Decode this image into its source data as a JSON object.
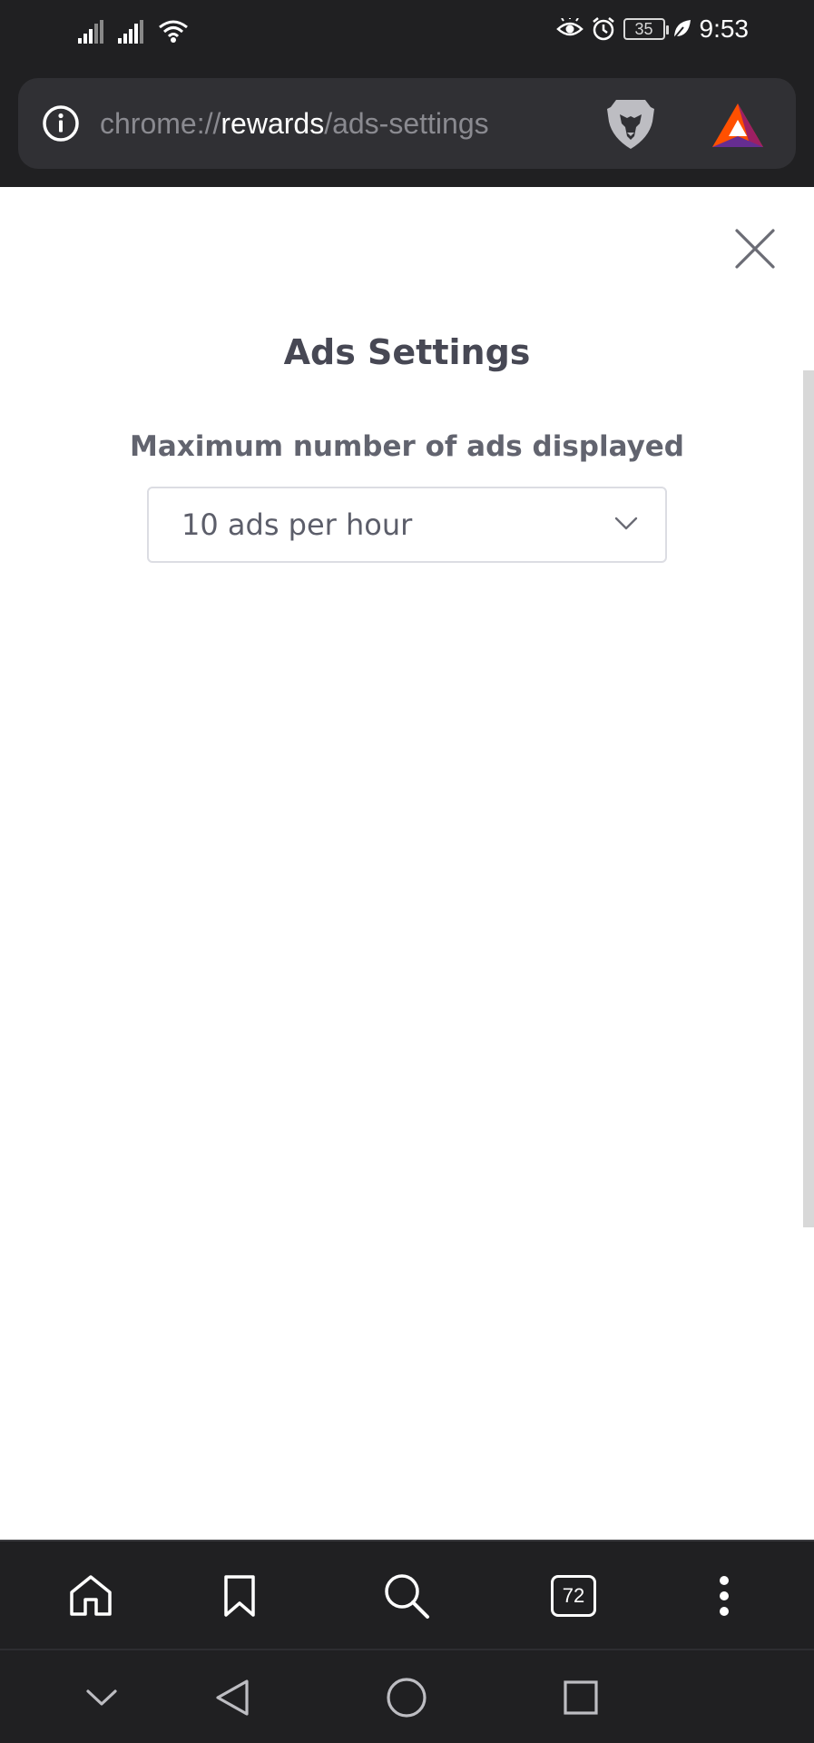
{
  "status_bar": {
    "time": "9:53",
    "battery_level": "35",
    "icons": [
      "signal-icon",
      "signal-icon",
      "wifi-icon",
      "eye-comfort-icon",
      "alarm-icon",
      "battery-icon",
      "leaf-icon"
    ]
  },
  "address_bar": {
    "url_scheme": "chrome://",
    "url_host": "rewards",
    "url_path": "/ads-settings"
  },
  "modal": {
    "title": "Ads Settings",
    "field_label": "Maximum number of ads displayed",
    "selected_option": "10 ads per hour"
  },
  "bottom_toolbar": {
    "tab_count": "72",
    "buttons": [
      "home-icon",
      "bookmark-icon",
      "search-icon",
      "tabs-icon",
      "menu-icon"
    ]
  },
  "system_nav": {
    "buttons": [
      "collapse-icon",
      "back-icon",
      "home-circle-icon",
      "recents-icon"
    ]
  },
  "colors": {
    "chrome_bg": "#202022",
    "url_bar_bg": "#303034",
    "title_text": "#474854",
    "label_text": "#62646f",
    "bat_orange": "#ff5000",
    "bat_purple": "#9e1f63",
    "bat_indigo": "#662d91"
  }
}
